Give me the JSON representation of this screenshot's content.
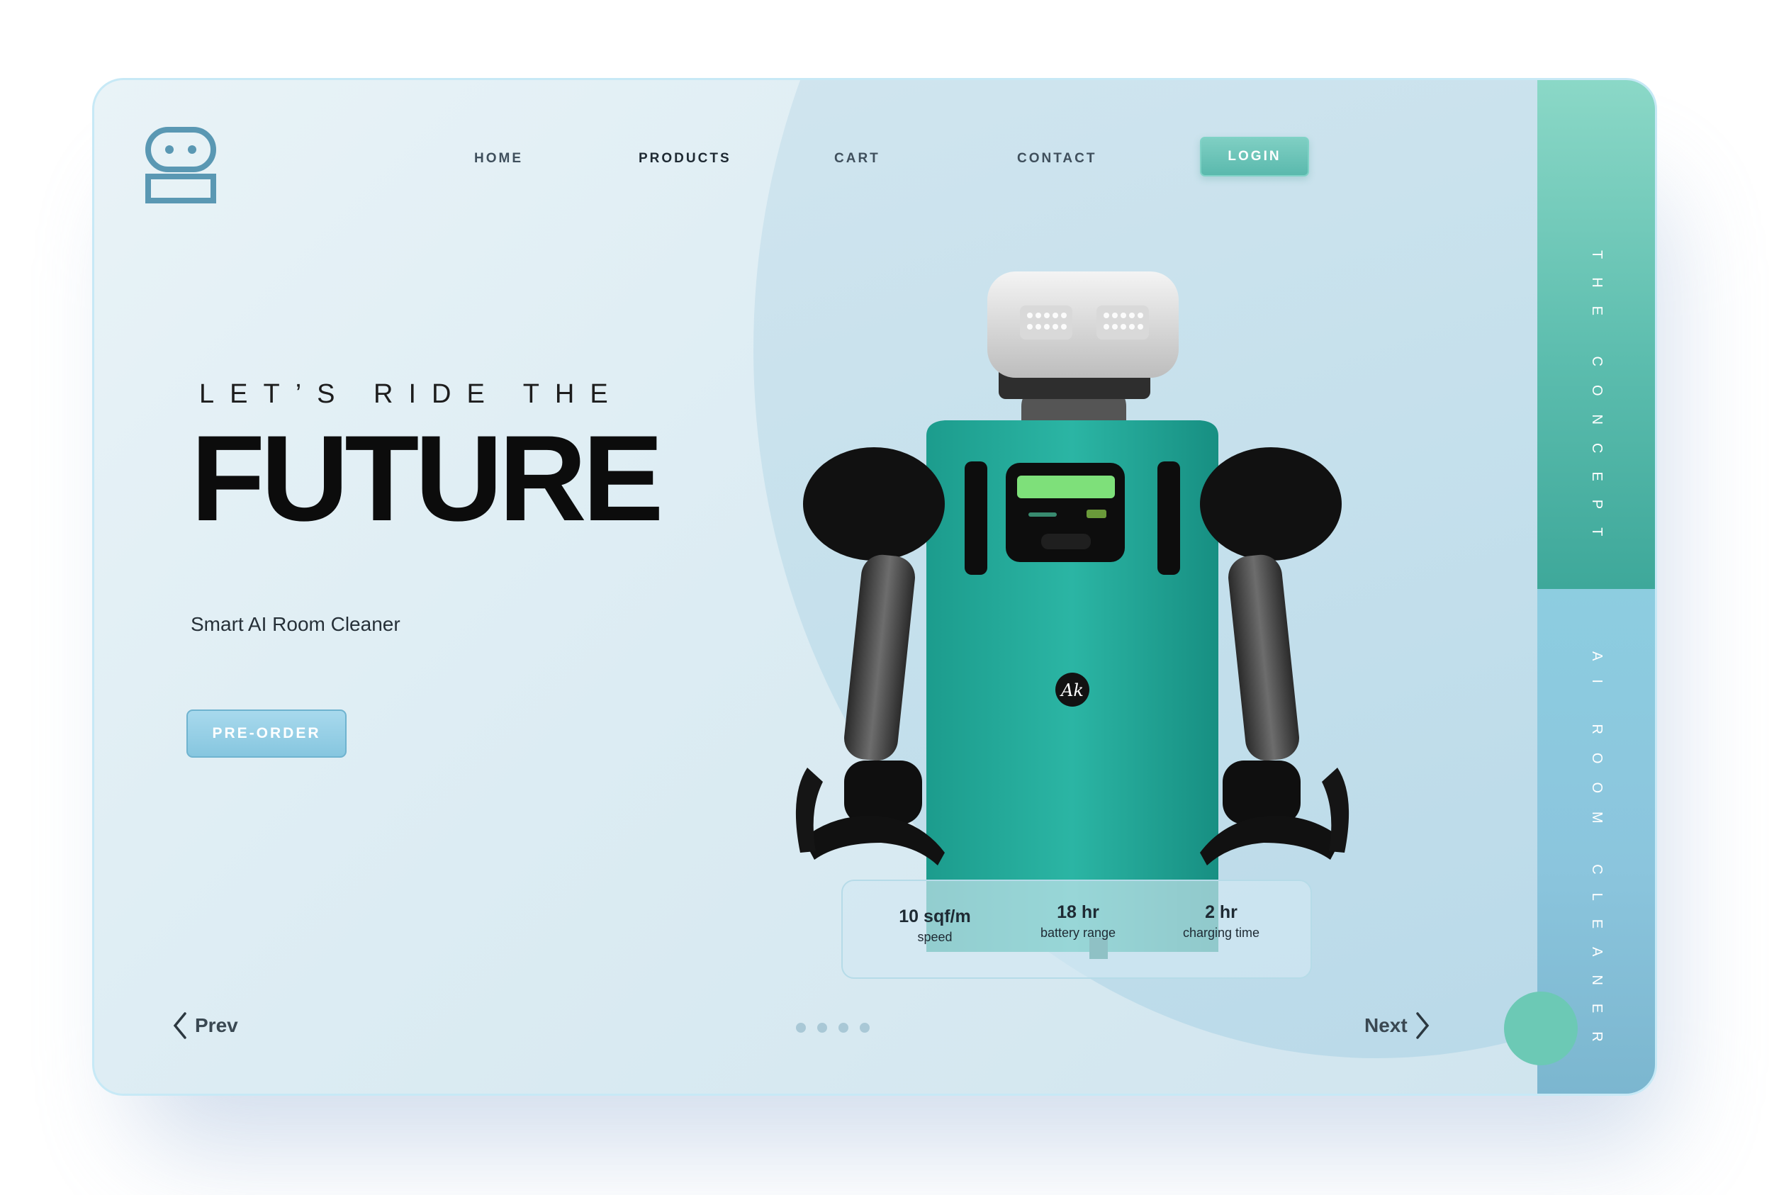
{
  "nav": {
    "items": [
      {
        "label": "HOME"
      },
      {
        "label": "PRODUCTS"
      },
      {
        "label": "CART"
      },
      {
        "label": "CONTACT"
      }
    ],
    "login_label": "LOGIN"
  },
  "hero": {
    "tagline": "LET’S RIDE THE",
    "title": "FUTURE",
    "subtitle": "Smart AI Room Cleaner",
    "cta_label": "PRE-ORDER"
  },
  "specs": [
    {
      "value": "10 sqf/m",
      "label": "speed"
    },
    {
      "value": "18 hr",
      "label": "battery range"
    },
    {
      "value": "2 hr",
      "label": "charging time"
    }
  ],
  "pager": {
    "prev_label": "Prev",
    "next_label": "Next",
    "page_count": 4
  },
  "side_panel": {
    "top_label": "THE CONCEPT",
    "bottom_label": "AI ROOM CLEANER"
  },
  "robot": {
    "badge_text": "Ak",
    "screen_color": "#7ee07a"
  },
  "colors": {
    "accent_teal": "#5ab9ad",
    "accent_blue": "#86c6df",
    "text_dark": "#0c0c0c"
  },
  "icons": {
    "logo": "robot-logo-icon",
    "prev": "chevron-left-icon",
    "next": "chevron-right-icon"
  }
}
